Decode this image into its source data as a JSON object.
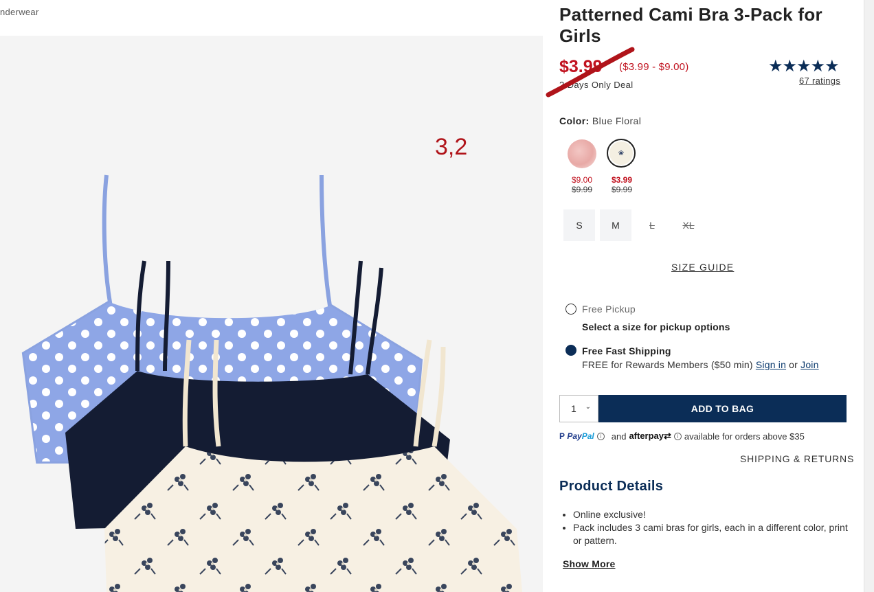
{
  "breadcrumb": {
    "text": "nderwear"
  },
  "overlay": {
    "label": "3,2"
  },
  "product": {
    "title": "Patterned Cami Bra 3-Pack for Girls",
    "sale_price": "$3.99",
    "price_range": "($3.99 - $9.00)",
    "deal_text": "2 Days Only Deal"
  },
  "rating": {
    "stars": "★★★★★",
    "value": 5,
    "count_label": "67 ratings"
  },
  "color": {
    "label": "Color:",
    "selected": "Blue Floral",
    "swatches": [
      {
        "name": "pink",
        "price": "$9.00",
        "original": "$9.99"
      },
      {
        "name": "blue-floral",
        "price": "$3.99",
        "original": "$9.99",
        "selected": true
      }
    ]
  },
  "sizes": [
    {
      "label": "S",
      "available": true
    },
    {
      "label": "M",
      "available": true
    },
    {
      "label": "L",
      "available": false
    },
    {
      "label": "XL",
      "available": false
    }
  ],
  "size_guide": "SIZE GUIDE",
  "fulfillment": {
    "pickup_label": "Free Pickup",
    "pickup_note": "Select a size for pickup options",
    "shipping_label": "Free Fast Shipping",
    "shipping_note": "FREE for Rewards Members ($50 min)",
    "sign_in": "Sign in",
    "or": "or",
    "join": "Join"
  },
  "cart": {
    "quantity": "1",
    "add_label": "ADD TO BAG"
  },
  "payment": {
    "paypal_pay": "Pay",
    "paypal_pal": "Pal",
    "and": "and",
    "afterpay": "afterpay",
    "available_text": "available for orders above $35"
  },
  "shipping_returns": "SHIPPING & RETURNS",
  "details": {
    "heading": "Product Details",
    "items": [
      "Online exclusive!",
      "Pack includes 3 cami bras for girls, each in a different color, print or pattern."
    ],
    "show_more": "Show More"
  },
  "colors": {
    "sale_red": "#c1121f",
    "navy": "#0b2d57",
    "annotation_red": "#b0141a"
  }
}
